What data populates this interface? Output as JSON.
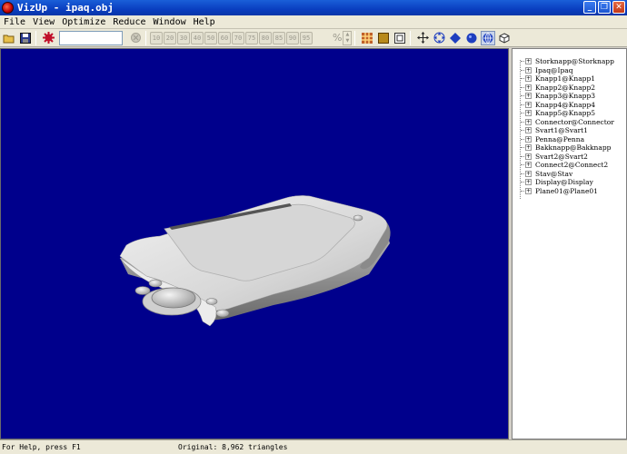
{
  "window": {
    "title": "VizUp - ipaq.obj",
    "minimize_glyph": "_",
    "maximize_glyph": "❐",
    "close_glyph": "✕"
  },
  "menu": [
    "File",
    "View",
    "Optimize",
    "Reduce",
    "Window",
    "Help"
  ],
  "toolbar": {
    "icons": [
      "open-folder-icon",
      "save-icon",
      "settings-gear-icon"
    ],
    "reduction_levels": [
      "10",
      "20",
      "30",
      "40",
      "50",
      "60",
      "70",
      "75",
      "80",
      "85",
      "90",
      "95"
    ],
    "percent_label": "%",
    "view_icons": [
      "grid-pattern-icon",
      "solid-box-icon",
      "frame-icon",
      "move-icon",
      "pan-icon",
      "diamond-icon",
      "sphere-icon",
      "globe-icon",
      "cube-icon"
    ]
  },
  "tree": {
    "items": [
      "Storknapp@Storknapp",
      "Ipaq@Ipaq",
      "Knapp1@Knapp1",
      "Knapp2@Knapp2",
      "Knapp3@Knapp3",
      "Knapp4@Knapp4",
      "Knapp5@Knapp5",
      "Connector@Connector",
      "Svart1@Svart1",
      "Penna@Penna",
      "Bakknapp@Bakknapp",
      "Svart2@Svart2",
      "Connect2@Connect2",
      "Stav@Stav",
      "Display@Display",
      "Plane01@Plane01"
    ],
    "toggle_glyph": "+"
  },
  "status": {
    "help": "For Help, press F1",
    "info": "Original: 8,962 triangles"
  },
  "colors": {
    "viewport_bg": "#00008c",
    "title_bg": "#0a3ec0"
  }
}
